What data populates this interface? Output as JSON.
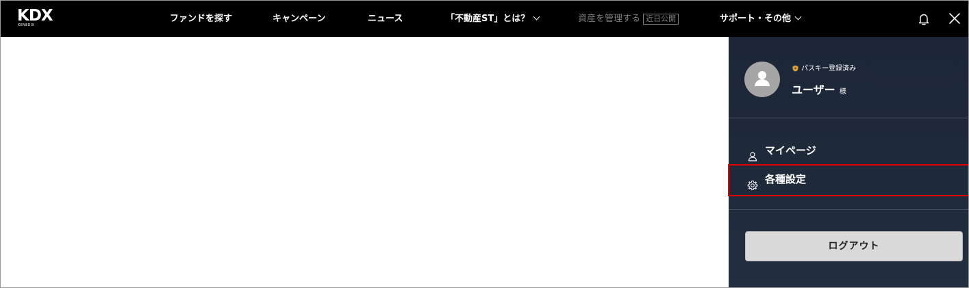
{
  "header": {
    "logo_main": "KDX",
    "logo_sub": "KENEDIX",
    "nav": [
      {
        "label": "ファンドを探す"
      },
      {
        "label": "キャンペーン"
      },
      {
        "label": "ニュース"
      },
      {
        "label": "「不動産ST」とは？"
      },
      {
        "label": "資産を管理する",
        "badge": "近日公開"
      },
      {
        "label": "サポート・その他"
      }
    ]
  },
  "panel": {
    "passkey_label": "パスキー登録済み",
    "user_name": "ユーザー",
    "user_suffix": "様",
    "menu": [
      {
        "label": "マイページ",
        "icon": "person-icon"
      },
      {
        "label": "各種設定",
        "icon": "gear-icon"
      }
    ],
    "logout_label": "ログアウト"
  },
  "colors": {
    "topbar_bg": "#000000",
    "panel_bg": "#1f2a3b",
    "highlight": "#e00000",
    "logout_bg": "#d9d9d9",
    "disabled_text": "#7d7d7d"
  }
}
